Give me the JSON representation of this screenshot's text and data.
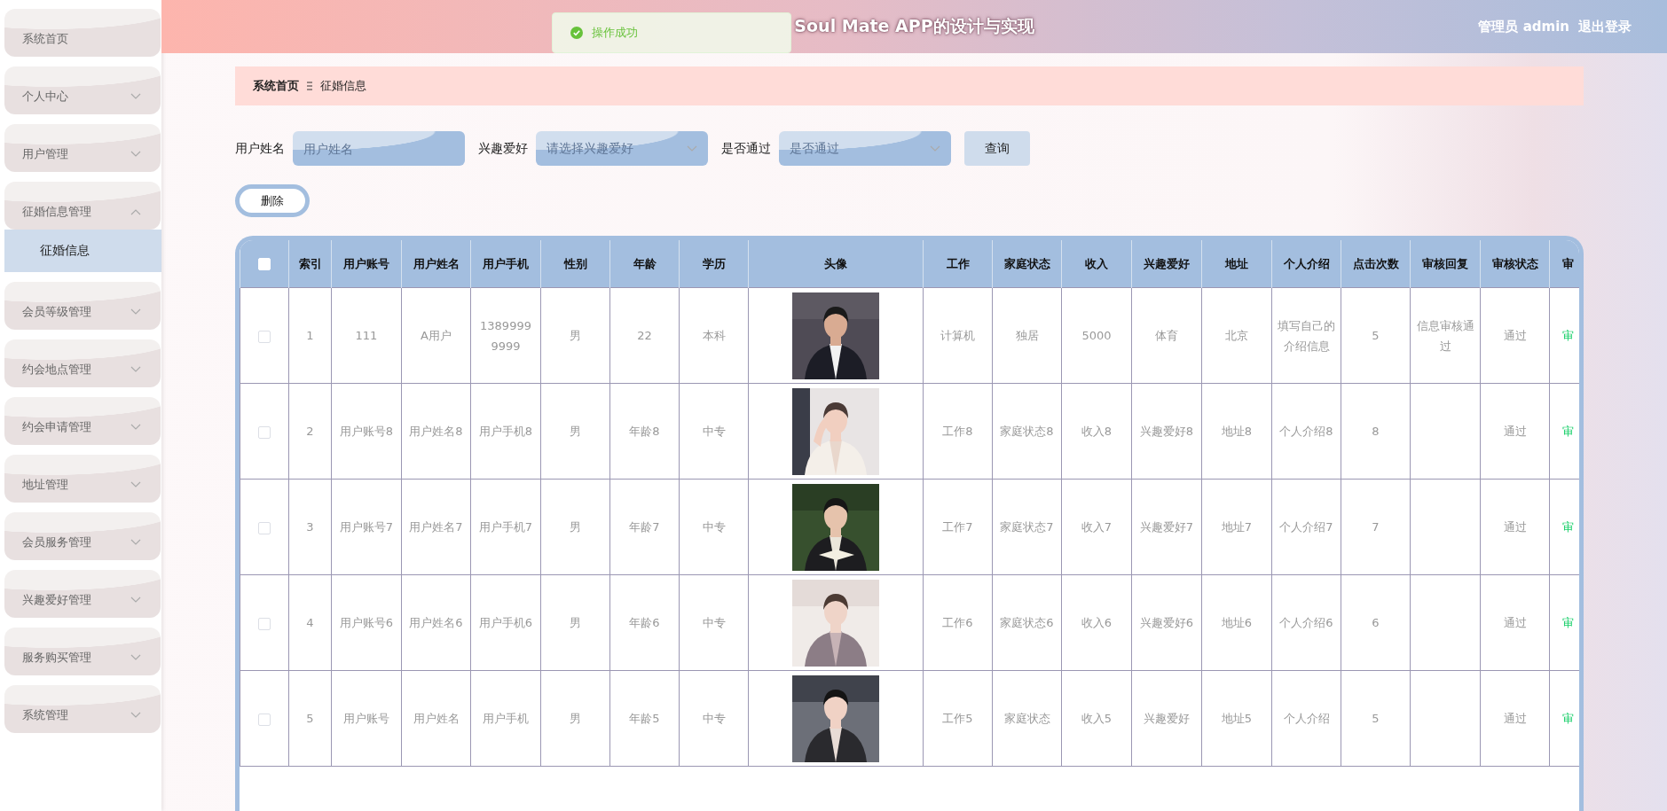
{
  "sidebar": {
    "items": [
      {
        "label": "系统首页",
        "kind": "link"
      },
      {
        "label": "个人中心",
        "kind": "menu",
        "expanded": false
      },
      {
        "label": "用户管理",
        "kind": "menu",
        "expanded": false
      },
      {
        "label": "征婚信息管理",
        "kind": "menu",
        "expanded": true,
        "children": [
          {
            "label": "征婚信息",
            "selected": true
          }
        ]
      },
      {
        "label": "会员等级管理",
        "kind": "menu",
        "expanded": false
      },
      {
        "label": "约会地点管理",
        "kind": "menu",
        "expanded": false
      },
      {
        "label": "约会申请管理",
        "kind": "menu",
        "expanded": false
      },
      {
        "label": "地址管理",
        "kind": "menu",
        "expanded": false
      },
      {
        "label": "会员服务管理",
        "kind": "menu",
        "expanded": false
      },
      {
        "label": "兴趣爱好管理",
        "kind": "menu",
        "expanded": false
      },
      {
        "label": "服务购买管理",
        "kind": "menu",
        "expanded": false
      },
      {
        "label": "系统管理",
        "kind": "menu",
        "expanded": false
      }
    ]
  },
  "header": {
    "title": "Soul Mate APP的设计与实现",
    "user": "管理员 admin",
    "logout": "退出登录"
  },
  "toast": {
    "message": "操作成功"
  },
  "breadcrumb": [
    "系统首页",
    "征婚信息"
  ],
  "filters": [
    {
      "label": "用户姓名",
      "kind": "input",
      "placeholder": "用户姓名"
    },
    {
      "label": "兴趣爱好",
      "kind": "select",
      "placeholder": "请选择兴趣爱好"
    },
    {
      "label": "是否通过",
      "kind": "select",
      "placeholder": "是否通过"
    }
  ],
  "search_button": "查询",
  "delete_button": "删除",
  "table": {
    "header_checked": false,
    "columns": [
      {
        "label": "索引",
        "kind": "text"
      },
      {
        "label": "用户账号",
        "kind": "text"
      },
      {
        "label": "用户姓名",
        "kind": "text"
      },
      {
        "label": "用户手机",
        "kind": "text"
      },
      {
        "label": "性别",
        "kind": "text"
      },
      {
        "label": "年龄",
        "kind": "text"
      },
      {
        "label": "学历",
        "kind": "text"
      },
      {
        "label": "头像",
        "kind": "picture"
      },
      {
        "label": "工作",
        "kind": "text"
      },
      {
        "label": "家庭状态",
        "kind": "text"
      },
      {
        "label": "收入",
        "kind": "text"
      },
      {
        "label": "兴趣爱好",
        "kind": "text"
      },
      {
        "label": "地址",
        "kind": "text"
      },
      {
        "label": "个人介绍",
        "kind": "text"
      },
      {
        "label": "点击次数",
        "kind": "text"
      },
      {
        "label": "审核回复",
        "kind": "text"
      },
      {
        "label": "审核状态",
        "kind": "text"
      },
      {
        "label": "审",
        "kind": "action"
      }
    ],
    "rows": [
      {
        "checked": false,
        "cells": [
          "1",
          "111",
          "A用户",
          "13899999999",
          "男",
          "22",
          "本科",
          null,
          "计算机",
          "独居",
          "5000",
          "体育",
          "北京",
          "填写自己的介绍信息",
          "5",
          "信息审核通过",
          "通过",
          "审"
        ]
      },
      {
        "checked": false,
        "cells": [
          "2",
          "用户账号8",
          "用户姓名8",
          "用户手机8",
          "男",
          "年龄8",
          "中专",
          null,
          "工作8",
          "家庭状态8",
          "收入8",
          "兴趣爱好8",
          "地址8",
          "个人介绍8",
          "8",
          null,
          "通过",
          "审"
        ]
      },
      {
        "checked": false,
        "cells": [
          "3",
          "用户账号7",
          "用户姓名7",
          "用户手机7",
          "男",
          "年龄7",
          "中专",
          null,
          "工作7",
          "家庭状态7",
          "收入7",
          "兴趣爱好7",
          "地址7",
          "个人介绍7",
          "7",
          null,
          "通过",
          "审"
        ]
      },
      {
        "checked": false,
        "cells": [
          "4",
          "用户账号6",
          "用户姓名6",
          "用户手机6",
          "男",
          "年龄6",
          "中专",
          null,
          "工作6",
          "家庭状态6",
          "收入6",
          "兴趣爱好6",
          "地址6",
          "个人介绍6",
          "6",
          null,
          "通过",
          "审"
        ]
      },
      {
        "checked": false,
        "cells": [
          "5",
          "用户账号",
          "用户姓名",
          "用户手机",
          "男",
          "年龄5",
          "中专",
          null,
          "工作5",
          "家庭状态",
          "收入5",
          "兴趣爱好",
          "地址5",
          "个人介绍",
          "5",
          null,
          "通过",
          "审"
        ]
      }
    ]
  }
}
